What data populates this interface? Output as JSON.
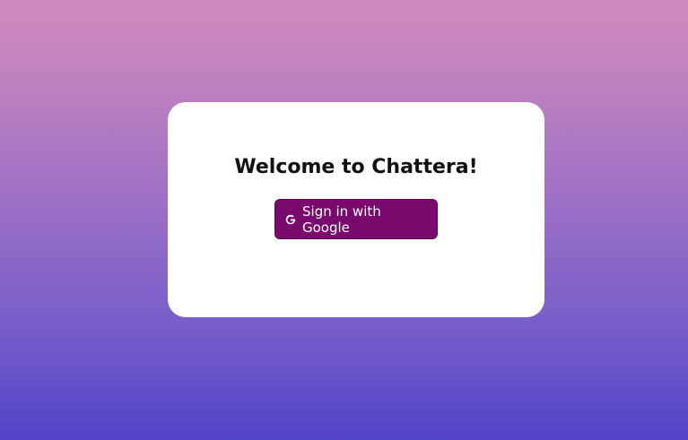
{
  "welcome_card": {
    "title": "Welcome to Chattera!",
    "signin_button_label": "Sign in with Google",
    "signin_button_icon": "google-icon"
  },
  "colors": {
    "button_bg": "#7a0a6e",
    "card_bg": "#ffffff",
    "gradient_top": "#d18bbd",
    "gradient_bottom": "#5244c9"
  }
}
